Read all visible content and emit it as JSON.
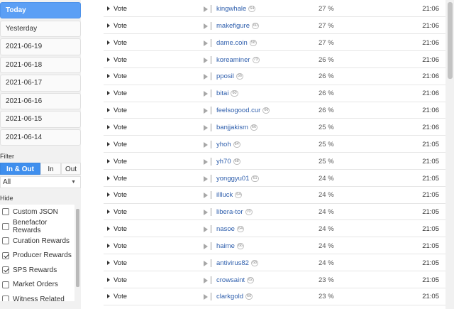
{
  "sidebar": {
    "dates": [
      "Today",
      "Yesterday",
      "2021-06-19",
      "2021-06-18",
      "2021-06-17",
      "2021-06-16",
      "2021-06-15",
      "2021-06-14"
    ],
    "filter_label": "Filter",
    "direction_tabs": [
      "In & Out",
      "In",
      "Out"
    ],
    "direction_select": "All",
    "hide_label": "Hide",
    "hide_options": [
      {
        "label": "Custom JSON",
        "checked": false
      },
      {
        "label": "Benefactor Rewards",
        "checked": false
      },
      {
        "label": "Curation Rewards",
        "checked": false
      },
      {
        "label": "Producer Rewards",
        "checked": true
      },
      {
        "label": "SPS Rewards",
        "checked": true
      },
      {
        "label": "Market Orders",
        "checked": false
      },
      {
        "label": "Witness Related",
        "checked": false
      }
    ]
  },
  "operations": [
    {
      "type": "Vote",
      "user": "kingwhale",
      "rep": "64",
      "pct": "27 %",
      "time": "21:06"
    },
    {
      "type": "Vote",
      "user": "makefigure",
      "rep": "60",
      "pct": "27 %",
      "time": "21:06"
    },
    {
      "type": "Vote",
      "user": "dame.coin",
      "rep": "58",
      "pct": "27 %",
      "time": "21:06"
    },
    {
      "type": "Vote",
      "user": "koreaminer",
      "rep": "73",
      "pct": "26 %",
      "time": "21:06"
    },
    {
      "type": "Vote",
      "user": "pposil",
      "rep": "56",
      "pct": "26 %",
      "time": "21:06"
    },
    {
      "type": "Vote",
      "user": "bitai",
      "rep": "60",
      "pct": "26 %",
      "time": "21:06"
    },
    {
      "type": "Vote",
      "user": "feelsogood.cur",
      "rep": "66",
      "pct": "26 %",
      "time": "21:06"
    },
    {
      "type": "Vote",
      "user": "banjjakism",
      "rep": "66",
      "pct": "25 %",
      "time": "21:06"
    },
    {
      "type": "Vote",
      "user": "yhoh",
      "rep": "64",
      "pct": "25 %",
      "time": "21:05"
    },
    {
      "type": "Vote",
      "user": "yh70",
      "rep": "68",
      "pct": "25 %",
      "time": "21:05"
    },
    {
      "type": "Vote",
      "user": "yonggyu01",
      "rep": "61",
      "pct": "24 %",
      "time": "21:05"
    },
    {
      "type": "Vote",
      "user": "illluck",
      "rep": "64",
      "pct": "24 %",
      "time": "21:05"
    },
    {
      "type": "Vote",
      "user": "libera-tor",
      "rep": "70",
      "pct": "24 %",
      "time": "21:05"
    },
    {
      "type": "Vote",
      "user": "nasoe",
      "rep": "64",
      "pct": "24 %",
      "time": "21:05"
    },
    {
      "type": "Vote",
      "user": "haime",
      "rep": "66",
      "pct": "24 %",
      "time": "21:05"
    },
    {
      "type": "Vote",
      "user": "antivirus82",
      "rep": "68",
      "pct": "24 %",
      "time": "21:05"
    },
    {
      "type": "Vote",
      "user": "crowsaint",
      "rep": "62",
      "pct": "23 %",
      "time": "21:05"
    },
    {
      "type": "Vote",
      "user": "clarkgold",
      "rep": "60",
      "pct": "23 %",
      "time": "21:05"
    }
  ]
}
